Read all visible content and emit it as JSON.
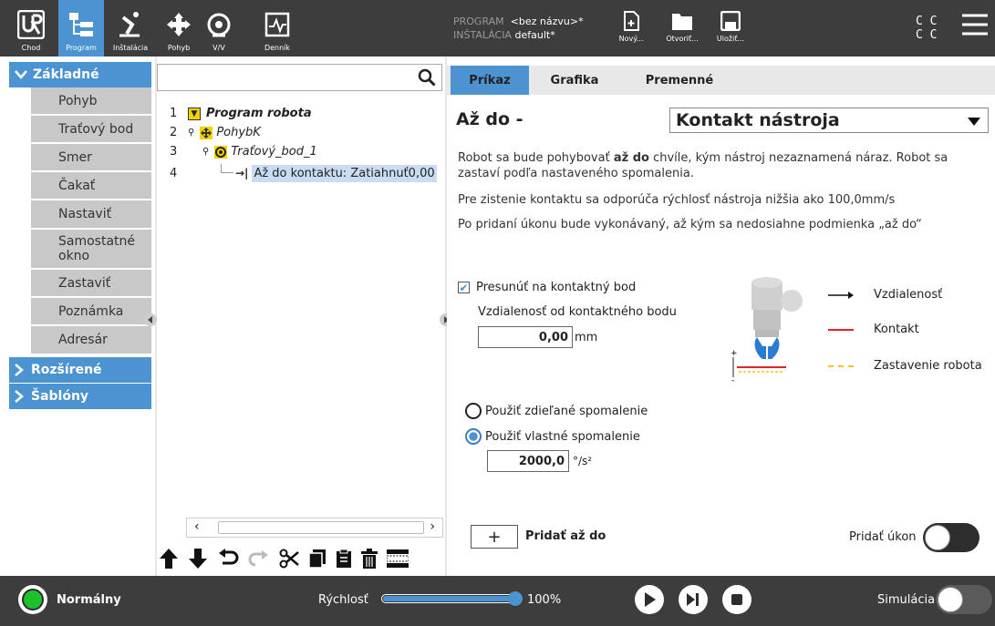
{
  "topnav": {
    "run": "Chod",
    "program": "Program",
    "installation": "Inštalácia",
    "move": "Pohyb",
    "io": "V/V",
    "log": "Denník"
  },
  "program_info": {
    "program_label": "PROGRAM",
    "program_value": "<bez názvu>*",
    "installation_label": "INŠTALÁCIA",
    "installation_value": "default*"
  },
  "file": {
    "new": "Nový...",
    "open": "Otvoriť...",
    "save": "Uložiť..."
  },
  "cc": {
    "row1": "C  C",
    "row2": "C  C"
  },
  "sidebar": {
    "basic": "Základné",
    "items": [
      "Pohyb",
      "Traťový bod",
      "Smer",
      "Čakať",
      "Nastaviť",
      "Samostatné okno",
      "Zastaviť",
      "Poznámka",
      "Adresár"
    ],
    "advanced": "Rozšírené",
    "templates": "Šablóny"
  },
  "tree": {
    "rows": [
      {
        "num": "1",
        "text": "Program robota"
      },
      {
        "num": "2",
        "text": "PohybK"
      },
      {
        "num": "3",
        "text": "Traťový_bod_1"
      },
      {
        "num": "4",
        "text": "Až do kontaktu: Zatiahnuť0,00"
      }
    ]
  },
  "tabs": {
    "command": "Príkaz",
    "graphics": "Grafika",
    "variables": "Premenné"
  },
  "command": {
    "title": "Až do -",
    "dropdown": "Kontakt nástroja",
    "desc1_a": "Robot sa bude pohybovať ",
    "desc1_b": "až do",
    "desc1_c": " chvíle, kým nástroj nezaznamená náraz. Robot sa zastaví podľa nastaveného spomalenia.",
    "desc2": "Pre zistenie kontaktu sa odporúča rýchlosť nástroja nižšia ako 100,0mm/s",
    "desc3": "Po pridaní úkonu bude vykonávaný, až kým sa nedosiahne podmienka „až do“",
    "move_to_contact": "Presunúť na kontaktný bod",
    "distance_label": "Vzdialenosť od kontaktného bodu",
    "distance_value": "0,00",
    "distance_unit": "mm",
    "legend": {
      "distance": "Vzdialenosť",
      "contact": "Kontakt",
      "stop": "Zastavenie robota"
    },
    "radio_shared": "Použiť zdieľané spomalenie",
    "radio_custom": "Použiť vlastné spomalenie",
    "decel_value": "2000,0",
    "decel_unit": "°/s²",
    "add_until_plus": "+",
    "add_until": "Pridať až do",
    "add_action": "Pridať úkon"
  },
  "bottom": {
    "status": "Normálny",
    "speed_label": "Rýchlosť",
    "speed_value": "100%",
    "speed_fraction": 1.0,
    "simulation": "Simulácia"
  },
  "colors": {
    "accent": "#4b93d1",
    "dark": "#3d3d3d",
    "status_green": "#1cc12d",
    "contact_red": "#e0262a",
    "stop_yellow": "#f5c02b"
  }
}
